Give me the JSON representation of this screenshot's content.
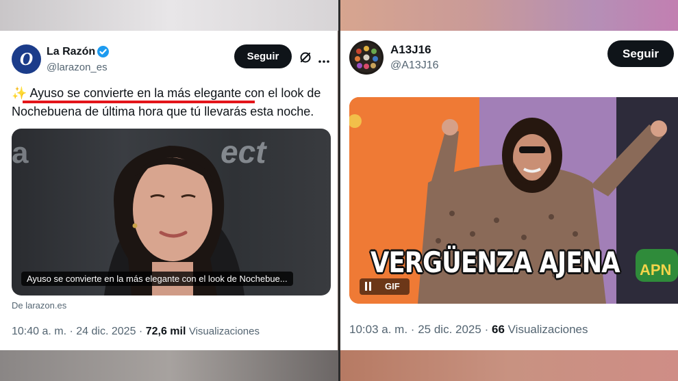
{
  "left_post": {
    "author_name": "La Razón",
    "author_handle": "@larazon_es",
    "avatar_letter": "O",
    "follow_label": "Seguir",
    "emoji": "✨",
    "text_highlight": "Ayuso se convierte en la más elegante",
    "text_rest_line1": " con el look de",
    "text_line2": "Nochebuena de última hora que tú llevarás esta noche.",
    "image_overlay_text": "Ayuso se convierte en la más elegante con el look de Nochebue...",
    "link_source": "De larazon.es",
    "time": "10:40 a. m.",
    "date": "24 dic. 2025",
    "views_count": "72,6 mil",
    "views_label": "Visualizaciones",
    "colors": {
      "underline": "#e3151a",
      "verified": "#1d9bf0",
      "avatar_bg": "#1b3c8a"
    }
  },
  "right_post": {
    "author_name": "A13J16",
    "author_handle": "@A13J16",
    "follow_label": "Seguir",
    "gif_caption": "VERGÜENZA AJENA",
    "gif_badge": "GIF",
    "pause_icon": "pause-icon",
    "corner_logo": "APN",
    "time": "10:03 a. m.",
    "date": "25 dic. 2025",
    "views_count": "66",
    "views_label": "Visualizaciones"
  },
  "meta_separator": "·"
}
